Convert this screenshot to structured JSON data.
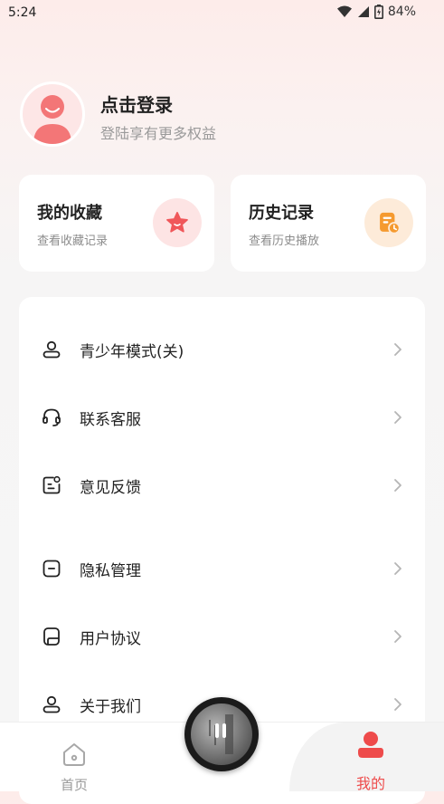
{
  "status_bar": {
    "time": "5:24",
    "battery": "84%"
  },
  "profile": {
    "title": "点击登录",
    "subtitle": "登陆享有更多权益"
  },
  "cards": [
    {
      "title": "我的收藏",
      "subtitle": "查看收藏记录",
      "icon": "star-icon",
      "icon_bg": "#fde4e4",
      "icon_color": "#f0575a"
    },
    {
      "title": "历史记录",
      "subtitle": "查看历史播放",
      "icon": "history-icon",
      "icon_bg": "#fdebd9",
      "icon_color": "#f59a2f"
    }
  ],
  "menu": [
    {
      "label": "青少年模式(关)",
      "icon": "teen-mode-icon"
    },
    {
      "label": "联系客服",
      "icon": "headset-icon"
    },
    {
      "label": "意见反馈",
      "icon": "feedback-icon"
    },
    {
      "label": "隐私管理",
      "icon": "privacy-icon"
    },
    {
      "label": "用户协议",
      "icon": "agreement-icon"
    },
    {
      "label": "关于我们",
      "icon": "about-icon"
    }
  ],
  "tabs": [
    {
      "label": "首页",
      "icon": "home-icon",
      "active": false
    },
    {
      "label": "我的",
      "icon": "person-icon",
      "active": true
    }
  ],
  "colors": {
    "accent": "#ee4b4b",
    "muted": "#9a9a9a"
  }
}
